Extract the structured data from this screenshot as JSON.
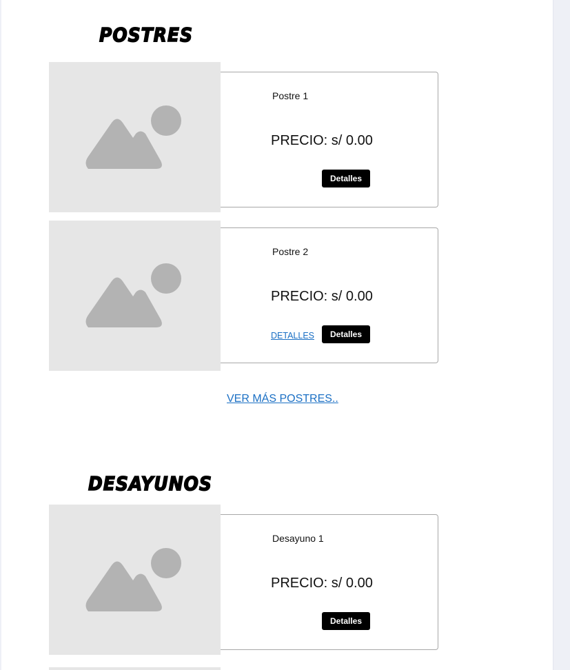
{
  "postres": {
    "title": "POSTRES",
    "items": [
      {
        "name": "Postre 1",
        "price": "PRECIO: s/ 0.00",
        "button_label": "Detalles"
      },
      {
        "name": "Postre 2",
        "price": "PRECIO: s/ 0.00",
        "link_label": "DETALLES",
        "button_label": "Detalles"
      }
    ],
    "more_link": "VER MÁS POSTRES.."
  },
  "desayunos": {
    "title": "DESAYUNOS",
    "items": [
      {
        "name": "Desayuno 1",
        "price": "PRECIO: s/ 0.00",
        "button_label": "Detalles"
      }
    ]
  },
  "colors": {
    "placeholder_bg": "#e6e6e6",
    "placeholder_icon": "#b3b3b3",
    "link": "#1a6fc4",
    "button_bg": "#000000",
    "sidebar_gutter": "#eef0f6"
  },
  "icons": {
    "product_image": "image-placeholder-icon"
  }
}
